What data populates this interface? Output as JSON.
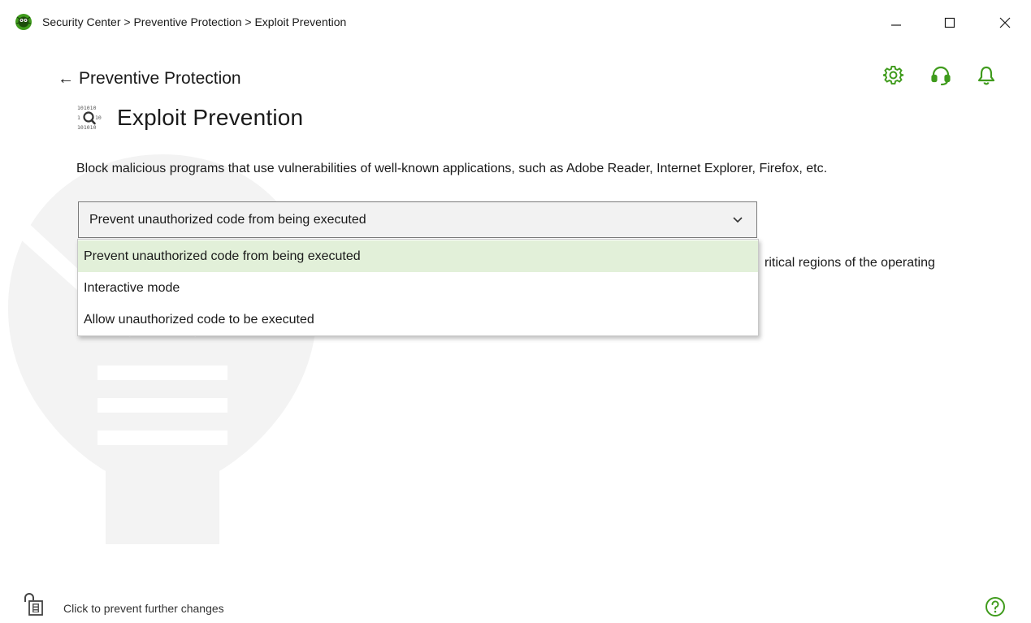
{
  "window": {
    "breadcrumb_title": "Security Center > Preventive Protection > Exploit Prevention"
  },
  "header": {
    "back_label": "Preventive Protection",
    "icons": [
      "settings-gear-icon",
      "support-headset-icon",
      "notifications-bell-icon"
    ]
  },
  "page": {
    "title": "Exploit Prevention",
    "description": "Block malicious programs that use vulnerabilities of well-known applications, such as Adobe Reader, Internet Explorer, Firefox, etc.",
    "partial_text_behind_dropdown": "ritical regions of the operating"
  },
  "mode_select": {
    "selected": "Prevent unauthorized code from being executed",
    "options": [
      "Prevent unauthorized code from being executed",
      "Interactive mode",
      "Allow unauthorized code to be executed"
    ]
  },
  "footer": {
    "lock_label": "Click to prevent further changes"
  },
  "colors": {
    "accent_green": "#3f9b1c",
    "selected_option_bg": "#e2f0d9"
  }
}
